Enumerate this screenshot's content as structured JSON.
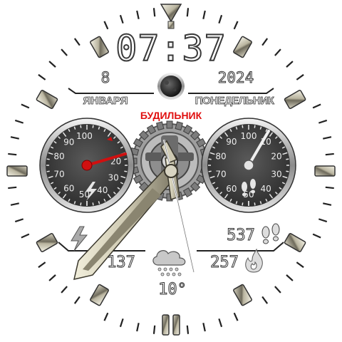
{
  "time": "07:37",
  "date": {
    "day": "8",
    "year": "2024",
    "month": "ЯНВАРЯ",
    "weekday": "ПОНЕДЕЛЬНИК"
  },
  "alarm_label": "БУДИЛЬНИК",
  "battery_gauge": {
    "scale_labels": [
      "100",
      "90",
      "80",
      "70",
      "60",
      "50",
      "40",
      "30",
      "20"
    ],
    "value_percent": 22,
    "icon": "lightning-icon",
    "needle_color": "#d01010"
  },
  "steps_gauge": {
    "scale_labels": [
      "100",
      "90",
      "80",
      "70",
      "60",
      "50",
      "40",
      "30",
      "20",
      "10"
    ],
    "value_percent": 5,
    "icon": "footprints-icon"
  },
  "stats": {
    "steps": "537",
    "calories": "137",
    "burned": "257",
    "temperature": "10°"
  },
  "icons": {
    "steps": "footprints-icon",
    "charge": "lightning-icon",
    "burned": "flame-icon",
    "weather": "rain-cloud-icon",
    "moon": "moon-phase-icon"
  },
  "colors": {
    "gauge_face": "#3c3c3c",
    "metal": "#c8c4b0",
    "accent_red": "#e01010",
    "text_white": "#ffffff"
  }
}
